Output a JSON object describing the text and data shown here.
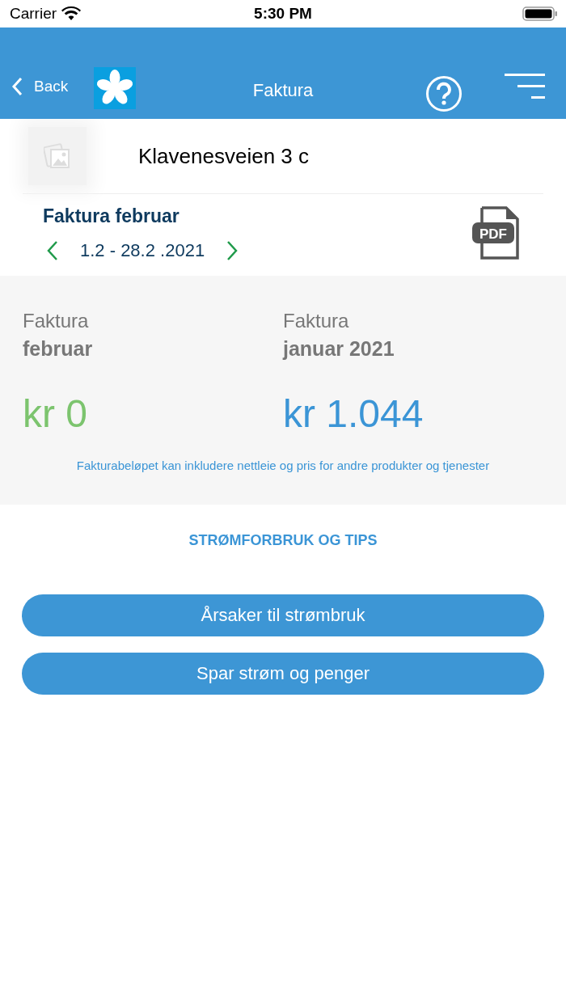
{
  "status_bar": {
    "carrier": "Carrier",
    "time": "5:30 PM"
  },
  "nav": {
    "back": "Back",
    "title": "Faktura"
  },
  "property": {
    "address": "Klavenesveien 3 c"
  },
  "invoice": {
    "title": "Faktura februar",
    "period": "1.2 - 28.2 .2021",
    "file_badge": "PDF"
  },
  "summary": {
    "columns": [
      {
        "label": "Faktura",
        "period": "februar",
        "amount": "kr 0",
        "color": "#7cc46e"
      },
      {
        "label": "Faktura",
        "period": "januar 2021",
        "amount": "kr 1.044",
        "color": "#3b95d6"
      }
    ],
    "note": "Fakturabeløpet kan inkludere nettleie og pris for andre produkter og tjenester"
  },
  "tips": {
    "heading": "STRØMFORBRUK OG TIPS",
    "buttons": [
      "Årsaker til strømbruk",
      "Spar strøm og penger"
    ]
  }
}
